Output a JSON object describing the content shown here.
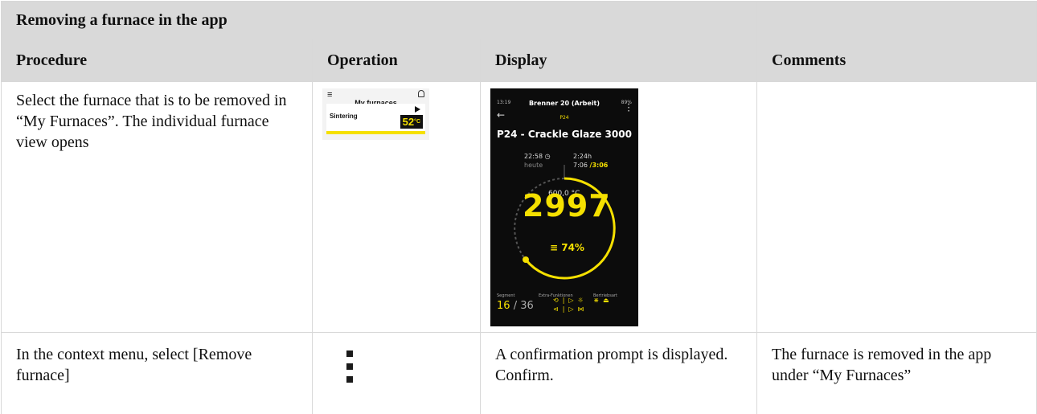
{
  "title": "Removing a furnace in the app",
  "headers": {
    "procedure": "Procedure",
    "operation": "Operation",
    "display": "Display",
    "comments": "Comments"
  },
  "rows": [
    {
      "procedure": "Select the furnace that is to be removed in “My Furnaces”. The individual furnace view opens",
      "operation_icon": "my-furnaces-screenshot",
      "display_icon": "furnace-view-screenshot",
      "comments": ""
    },
    {
      "procedure": "In the context menu, select [Remove furnace]",
      "operation_icon": "kebab-menu-icon",
      "display": "A confirmation prompt is displayed. Confirm.",
      "comments": "The furnace is removed in the app under “My Furnaces”"
    }
  ],
  "my_furnaces_mock": {
    "title": "My furnaces",
    "item": "Sintering",
    "temperature": "52",
    "unit": "°C"
  },
  "phone_mock": {
    "status_time": "13:19",
    "status_right": "89%",
    "furnace": "Brenner 20 (Arbeit)",
    "program_code": "P24",
    "program": "P24 - Crackle Glaze 3000",
    "start_time": "22:58",
    "start_day": "heute",
    "duration": "2:24h",
    "remaining": "7:06",
    "remaining_total": "/3:06",
    "setpoint": "600,0 °C",
    "current_temp": "2997",
    "power": "74%",
    "label_segment": "Segment",
    "label_extra": "Extra-Funktionen",
    "label_mode": "Bertriebsart",
    "segment_current": "16",
    "segment_total": "/ 36"
  },
  "colors": {
    "header_bg": "#d9d9d9",
    "accent_yellow": "#f5e000",
    "phone_bg": "#0c0c0c"
  }
}
